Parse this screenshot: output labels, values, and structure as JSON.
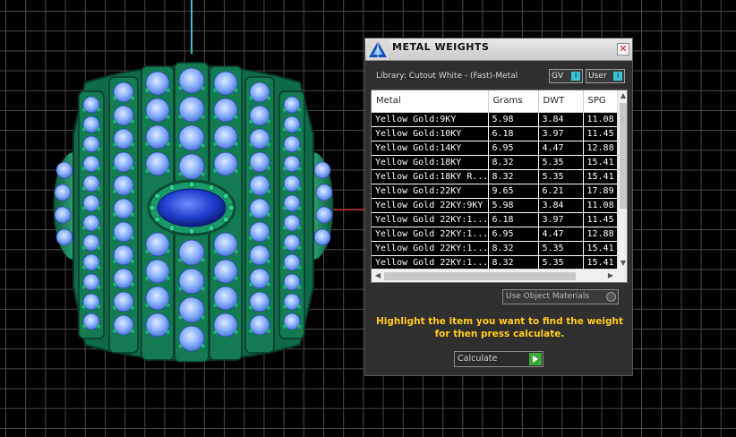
{
  "panel": {
    "title": "METAL WEIGHTS",
    "close_glyph": "✕",
    "library_label": "Library: Cutout White - (Fast)-Metal",
    "gv_label": "GV",
    "user_label": "User",
    "toggle_knob_glyph": "I"
  },
  "table": {
    "columns": [
      "Metal",
      "Grams",
      "DWT",
      "SPG"
    ],
    "rows": [
      [
        "Yellow Gold:9KY",
        "5.98",
        "3.84",
        "11.08"
      ],
      [
        "Yellow Gold:10KY",
        "6.18",
        "3.97",
        "11.45"
      ],
      [
        "Yellow Gold:14KY",
        "6.95",
        "4.47",
        "12.88"
      ],
      [
        "Yellow Gold:18KY",
        "8.32",
        "5.35",
        "15.41"
      ],
      [
        "Yellow Gold:18KY R...",
        "8.32",
        "5.35",
        "15.41"
      ],
      [
        "Yellow Gold:22KY",
        "9.65",
        "6.21",
        "17.89"
      ],
      [
        "Yellow Gold 22KY:9KY",
        "5.98",
        "3.84",
        "11.08"
      ],
      [
        "Yellow Gold 22KY:1...",
        "6.18",
        "3.97",
        "11.45"
      ],
      [
        "Yellow Gold 22KY:1...",
        "6.95",
        "4.47",
        "12.88"
      ],
      [
        "Yellow Gold 22KY:1...",
        "8.32",
        "5.35",
        "15.41"
      ],
      [
        "Yellow Gold 22KY:1...",
        "8.32",
        "5.35",
        "15.41"
      ]
    ]
  },
  "controls": {
    "use_object_materials": "Use Object Materials",
    "instructions_line1": "Highlight the item you want to find the weight",
    "instructions_line2": "for then press calculate.",
    "calculate_label": "Calculate"
  },
  "colors": {
    "accent": "#3ac1d8",
    "instructions": "#ffcc1a",
    "gem_blue": "#1f46d6",
    "metal_green": "#1e8a5e",
    "stone_light": "#8ab4ff"
  }
}
